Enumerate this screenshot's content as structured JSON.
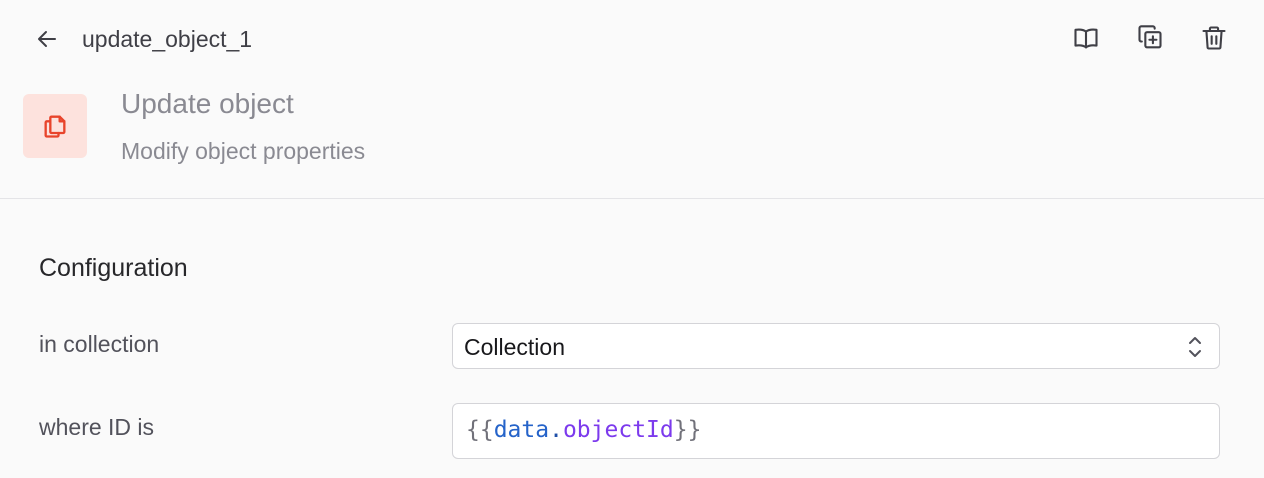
{
  "topbar": {
    "node_id": "update_object_1"
  },
  "header": {
    "title": "Update object",
    "subtitle": "Modify object properties"
  },
  "configuration": {
    "title": "Configuration",
    "collection": {
      "label": "in collection",
      "value": "Collection"
    },
    "where_id": {
      "label": "where ID is",
      "tokens": {
        "open": "{{",
        "var": "data",
        "dot": ".",
        "prop": "objectId",
        "close": "}}"
      }
    }
  },
  "colors": {
    "accent": "#e8442b",
    "tile_bg": "#fde2dd",
    "var": "#2563c9",
    "prop": "#7c3aed"
  },
  "icons": [
    "back-arrow-icon",
    "book-icon",
    "duplicate-icon",
    "trash-icon",
    "copy-icon",
    "chevron-up-down-icon"
  ]
}
